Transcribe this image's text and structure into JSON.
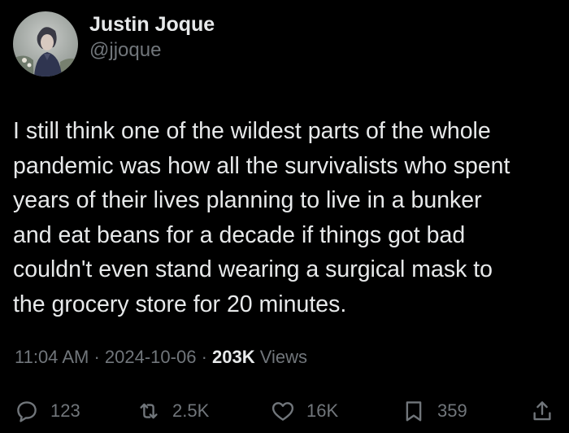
{
  "author": {
    "display_name": "Justin Joque",
    "handle": "@jjoque"
  },
  "tweet": {
    "text": "I still think one of the wildest parts of the whole\npandemic was how all the survivalists who spent\nyears of their lives planning to live in a bunker\nand eat beans for a decade if things got bad\ncouldn't even stand wearing a surgical mask to\nthe grocery store for 20 minutes."
  },
  "meta": {
    "time": "11:04 AM",
    "separator": "·",
    "date": "2024-10-06",
    "views_count": "203K",
    "views_label": "Views"
  },
  "actions": {
    "replies": "123",
    "reposts": "2.5K",
    "likes": "16K",
    "bookmarks": "359"
  },
  "icons": {
    "reply": "reply-icon",
    "repost": "repost-icon",
    "like": "like-icon",
    "bookmark": "bookmark-icon",
    "share": "share-icon"
  },
  "colors": {
    "background": "#000000",
    "text_primary": "#e7e9ea",
    "text_secondary": "#71767b"
  }
}
